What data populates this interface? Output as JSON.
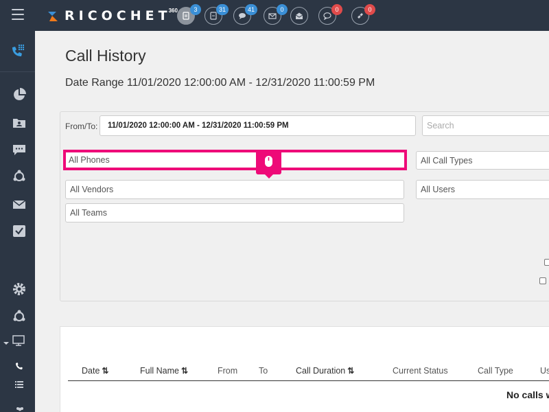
{
  "brand": {
    "name": "RICOCHET",
    "superscript": "360"
  },
  "topbar_icons": [
    {
      "name": "documents-icon",
      "count": "3",
      "badge_color": "#3a8fd6"
    },
    {
      "name": "file-icon",
      "count": "31",
      "badge_color": "#3a8fd6"
    },
    {
      "name": "chat-bubbles-icon",
      "count": "41",
      "badge_color": "#3a8fd6"
    },
    {
      "name": "mail-icon",
      "count": "0",
      "badge_color": "#3a8fd6"
    },
    {
      "name": "open-mail-icon",
      "count": "",
      "badge_color": ""
    },
    {
      "name": "comment-icon",
      "count": "0",
      "badge_color": "#e04b4b"
    },
    {
      "name": "ticket-icon",
      "count": "0",
      "badge_color": "#e04b4b"
    }
  ],
  "page": {
    "title": "Call History",
    "date_range": "Date Range 11/01/2020 12:00:00 AM - 12/31/2020 11:00:59 PM"
  },
  "filters": {
    "from_to_label": "From/To:",
    "date_value": "11/01/2020 12:00:00 AM - 12/31/2020 11:00:59 PM",
    "search_placeholder": "Search",
    "phones": "All Phones",
    "call_types": "All Call Types",
    "vendors": "All Vendors",
    "users": "All Users",
    "teams": "All Teams"
  },
  "table": {
    "columns": [
      {
        "label": "Date",
        "sortable": true
      },
      {
        "label": "Full Name",
        "sortable": true
      },
      {
        "label": "From",
        "sortable": false
      },
      {
        "label": "To",
        "sortable": false
      },
      {
        "label": "Call Duration",
        "sortable": true
      },
      {
        "label": "Current Status",
        "sortable": false
      },
      {
        "label": "Call Type",
        "sortable": false
      },
      {
        "label": "Us",
        "sortable": false
      }
    ],
    "sort_glyph": "⇅",
    "empty_message": "No calls w"
  },
  "colors": {
    "topbar": "#2c3644",
    "highlight": "#ee0a78",
    "accent": "#3a8fd6"
  }
}
